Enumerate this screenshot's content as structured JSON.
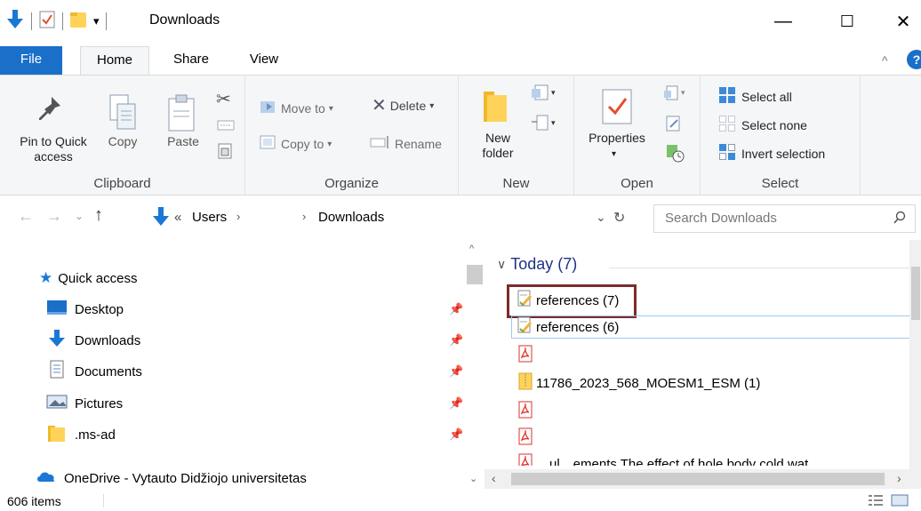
{
  "window": {
    "title": "Downloads",
    "minimize": "—",
    "maximize": "☐",
    "close": "✕"
  },
  "tabs": {
    "file": "File",
    "home": "Home",
    "share": "Share",
    "view": "View"
  },
  "ribbon": {
    "clipboard": {
      "label": "Clipboard",
      "pin": "Pin to Quick\naccess",
      "copy": "Copy",
      "paste": "Paste"
    },
    "organize": {
      "label": "Organize",
      "move_to": "Move to",
      "copy_to": "Copy to",
      "delete": "Delete",
      "rename": "Rename"
    },
    "new": {
      "label": "New",
      "new_folder": "New\nfolder"
    },
    "open": {
      "label": "Open",
      "properties": "Properties"
    },
    "select": {
      "label": "Select",
      "select_all": "Select all",
      "select_none": "Select none",
      "invert": "Invert selection"
    }
  },
  "address": {
    "overflow": "«",
    "segment_users": "Users",
    "segment_downloads": "Downloads",
    "search_placeholder": "Search Downloads"
  },
  "nav": {
    "quick_access": "Quick access",
    "items": [
      {
        "label": "Desktop",
        "icon": "desktop-icon"
      },
      {
        "label": "Downloads",
        "icon": "download-arrow-icon"
      },
      {
        "label": "Documents",
        "icon": "documents-icon"
      },
      {
        "label": "Pictures",
        "icon": "pictures-icon"
      },
      {
        "label": ".ms-ad",
        "icon": "folder-icon"
      }
    ],
    "onedrive": "OneDrive - Vytauto Didžiojo universitetas"
  },
  "content": {
    "group_header": "Today (7)",
    "files": [
      {
        "name": "references (7)",
        "icon": "text-file-icon"
      },
      {
        "name": "references (6)",
        "icon": "text-file-icon"
      },
      {
        "name": "",
        "icon": "pdf-icon"
      },
      {
        "name": "11786_2023_568_MOESM1_ESM (1)",
        "icon": "zip-folder-icon"
      },
      {
        "name": "",
        "icon": "pdf-icon"
      },
      {
        "name": "",
        "icon": "pdf-icon"
      },
      {
        "name": "…ul…ements The effect of hole body cold wat",
        "icon": "pdf-icon"
      }
    ]
  },
  "status": {
    "item_count": "606 items"
  },
  "colors": {
    "accent": "#1a6fc9",
    "highlight_box": "#7b2b2b",
    "group_header": "#1e3287",
    "pin_icon": "#555555"
  }
}
